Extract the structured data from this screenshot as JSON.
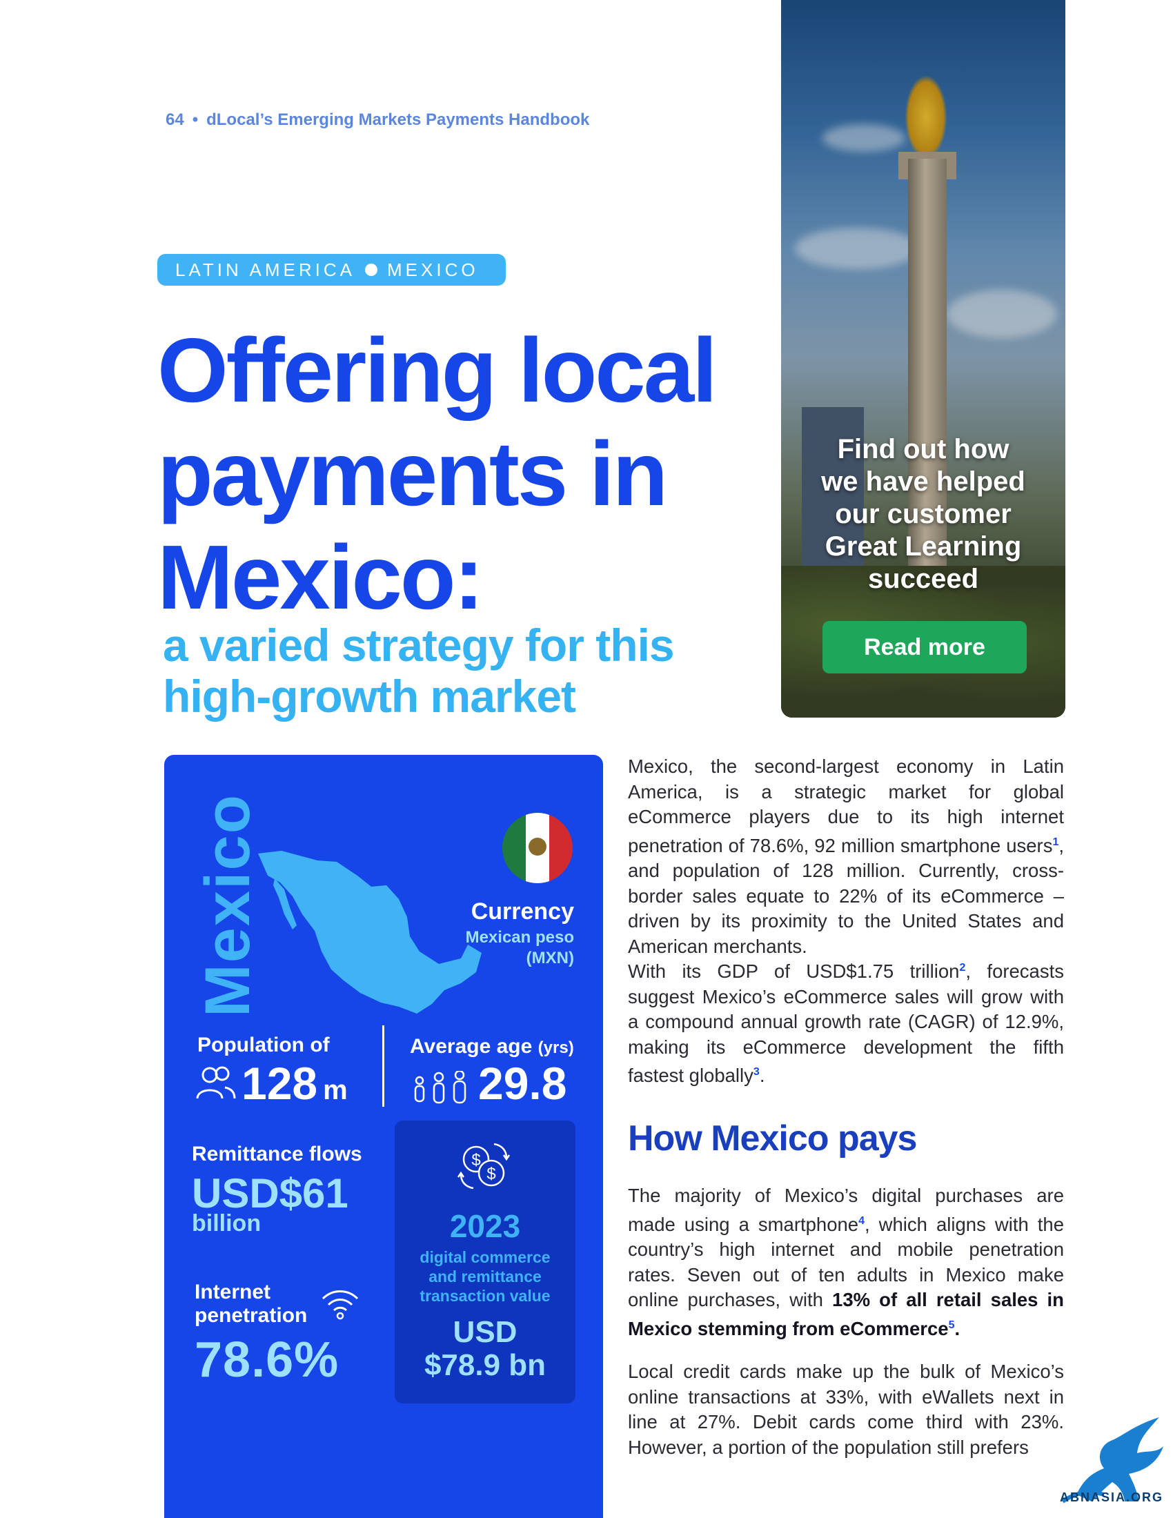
{
  "header": {
    "page_number": "64",
    "separator": "•",
    "publication": "dLocal’s Emerging Markets Payments Handbook"
  },
  "region_tag": {
    "region": "LATIN AMERICA",
    "country": "MEXICO"
  },
  "title": {
    "line1": "Offering local",
    "line2": "payments in",
    "line3": "Mexico:"
  },
  "subtitle": {
    "line1": "a varied strategy for this",
    "line2": "high-growth market"
  },
  "promo": {
    "line1": "Find out how",
    "line2": "we have helped",
    "line3": "our customer",
    "line4": "Great Learning",
    "line5": "succeed",
    "button_label": "Read more"
  },
  "country_panel": {
    "country_name": "Mexico",
    "currency_label": "Currency",
    "currency_value_line1": "Mexican peso",
    "currency_value_line2": "(MXN)",
    "population_label": "Population of",
    "population_value": "128",
    "population_unit": "m",
    "age_label": "Average age",
    "age_unit": "(yrs)",
    "age_value": "29.8",
    "remittance_label": "Remittance flows",
    "remittance_value": "USD$61",
    "remittance_unit": "billion",
    "internet_label_line1": "Internet",
    "internet_label_line2": "penetration",
    "internet_value": "78.6%",
    "box_year": "2023",
    "box_desc_line1": "digital commerce",
    "box_desc_line2": "and remittance",
    "box_desc_line3": "transaction value",
    "box_currency": "USD",
    "box_amount": "$78.9 bn",
    "colors": {
      "panel": "#1746e8",
      "accent": "#3fb3f5",
      "light": "#9ee0ff"
    }
  },
  "body": {
    "p1": "Mexico, the second-largest economy in Latin America, is a strategic market for global eCommerce players due to its high internet penetration of 78.6%, 92 million smartphone users",
    "p1_ref": "1",
    "p1_rest": ", and population of 128 million. Currently, cross-border sales equate to 22% of its eCommerce – driven by its proximity to the United States and American merchants.",
    "p2": "With its GDP of USD$1.75 trillion",
    "p2_ref": "2",
    "p2_rest": ", forecasts suggest Mexico’s eCommerce sales will grow with a compound annual growth rate (CAGR) of 12.9%, making its eCommerce development the fifth fastest globally",
    "p2_ref2": "3",
    "p2_end": ".",
    "heading": "How Mexico pays",
    "p3": "The majority of Mexico’s digital purchases are made using a smartphone",
    "p3_ref": "4",
    "p3_rest": ", which aligns with the country’s high internet and mobile penetration rates. Seven out of ten adults in Mexico make online purchases, with ",
    "p3_bold": "13% of all retail sales in Mexico stemming from eCommerce",
    "p3_ref2": "5",
    "p3_end": ".",
    "p4": "Local credit cards make up the bulk of Mexico’s online transactions at 33%, with eWallets next in line at 27%. Debit cards come third with 23%. However, a portion of the population still prefers"
  },
  "watermark": {
    "text": "ABNASIA.ORG"
  }
}
